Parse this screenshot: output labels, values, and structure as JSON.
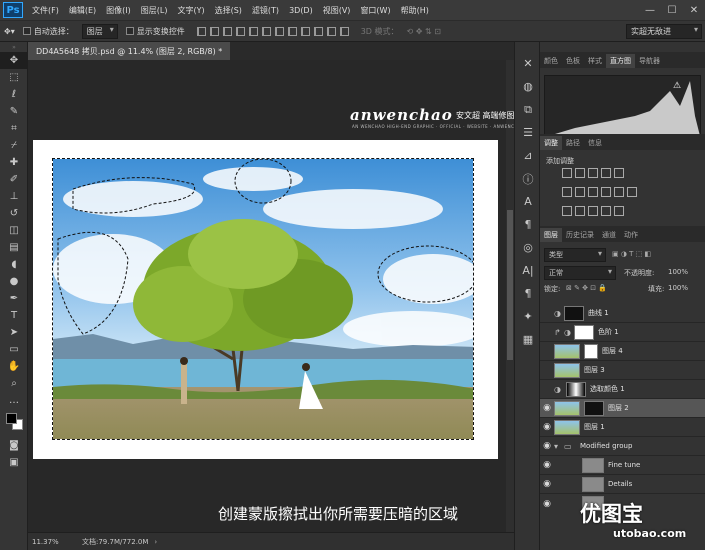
{
  "app": {
    "logo": "Ps"
  },
  "menu": [
    "文件(F)",
    "编辑(E)",
    "图像(I)",
    "图层(L)",
    "文字(Y)",
    "选择(S)",
    "滤镜(T)",
    "3D(D)",
    "视图(V)",
    "窗口(W)",
    "帮助(H)"
  ],
  "window_controls": [
    "—",
    "☐",
    "✕"
  ],
  "options": {
    "auto_select_label": "自动选择：",
    "auto_select_value": "图层",
    "show_transform_label": "显示变换控件",
    "mode_3d_label": "3D 模式：",
    "workspace_value": "实超无敌进"
  },
  "document": {
    "tab_title": "DD4A5648 拷贝.psd @ 11.4% (图层 2, RGB/8) *",
    "zoom": "11.37%",
    "doc_size": "文档:79.7M/772.0M"
  },
  "canvas": {
    "brand": "anwenchao",
    "brand_cn": "安文超 高端修图",
    "brand_sub": "AN WENCHAO HIGH-END GRAPHIC · OFFICIAL · WEBSITE · ANWENCHAO.COM",
    "caption": "创建蒙版擦拭出你所需要压暗的区域"
  },
  "panels": {
    "top_tabs": [
      "颜色",
      "色板",
      "样式",
      "直方图",
      "导航器"
    ],
    "top_active": "直方图",
    "adj_tabs": [
      "调整",
      "路径",
      "信息"
    ],
    "adj_title": "添加调整",
    "layer_tabs": [
      "图层",
      "历史记录",
      "通道",
      "动作"
    ]
  },
  "layers_panel": {
    "filter_value": "类型",
    "blend_mode": "正常",
    "opacity_label": "不透明度:",
    "opacity_value": "100%",
    "lock_label": "锁定:",
    "fill_label": "填充:",
    "fill_value": "100%",
    "layers": [
      {
        "name": "曲线 1",
        "kind": "adjust"
      },
      {
        "name": "色阶 1",
        "kind": "adjust"
      },
      {
        "name": "图层 4",
        "kind": "image"
      },
      {
        "name": "图层 3",
        "kind": "image"
      },
      {
        "name": "选取颜色 1",
        "kind": "adjust"
      },
      {
        "name": "图层 2",
        "kind": "image"
      },
      {
        "name": "图层 1",
        "kind": "image"
      },
      {
        "name": "Modified group",
        "kind": "group"
      },
      {
        "name": "Fine tune",
        "kind": "grey"
      },
      {
        "name": "Details",
        "kind": "grey"
      }
    ]
  },
  "watermark": {
    "text": "优图宝",
    "url": "utobao.com"
  },
  "colors": {
    "accent": "#31a8ff",
    "bg": "#282828",
    "panel": "#333333"
  }
}
